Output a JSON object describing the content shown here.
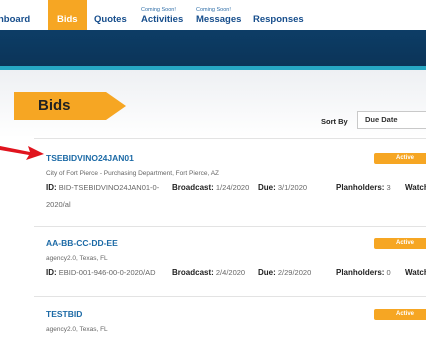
{
  "nav": {
    "items": [
      {
        "label": "nboard",
        "soon": ""
      },
      {
        "label": "Bids",
        "soon": ""
      },
      {
        "label": "Quotes",
        "soon": ""
      },
      {
        "label": "Activities",
        "soon": "Coming Soon!"
      },
      {
        "label": "Messages",
        "soon": "Coming Soon!"
      },
      {
        "label": "Responses",
        "soon": ""
      }
    ]
  },
  "page": {
    "title": "Bids"
  },
  "sort": {
    "label": "Sort By",
    "value": "Due Date"
  },
  "labels": {
    "id": "ID:",
    "broadcast": "Broadcast:",
    "due": "Due:",
    "planholders": "Planholders:",
    "watch": "Watch"
  },
  "rows": [
    {
      "title": "TSEBIDVINO24JAN01",
      "agency": "City of Fort Pierce - Purchasing Department, Fort Pierce, AZ",
      "id": "BID-TSEBIDVINO24JAN01-0-",
      "id_cont": "2020/al",
      "broadcast": "1/24/2020",
      "due": "3/1/2020",
      "planholders": "3",
      "status": "Active"
    },
    {
      "title": "AA-BB-CC-DD-EE",
      "agency": "agency2.0, Texas, FL",
      "id": "EBID-001-946-00-0-2020/AD",
      "id_cont": "",
      "broadcast": "2/4/2020",
      "due": "2/29/2020",
      "planholders": "0",
      "status": "Active"
    },
    {
      "title": "TESTBID",
      "agency": "agency2.0, Texas, FL",
      "id": "",
      "id_cont": "",
      "broadcast": "",
      "due": "",
      "planholders": "",
      "status": "Active"
    }
  ],
  "colors": {
    "accent": "#f6a623",
    "navy": "#0d3d66",
    "link": "#1c6aa6",
    "arrow": "#e0141e"
  }
}
